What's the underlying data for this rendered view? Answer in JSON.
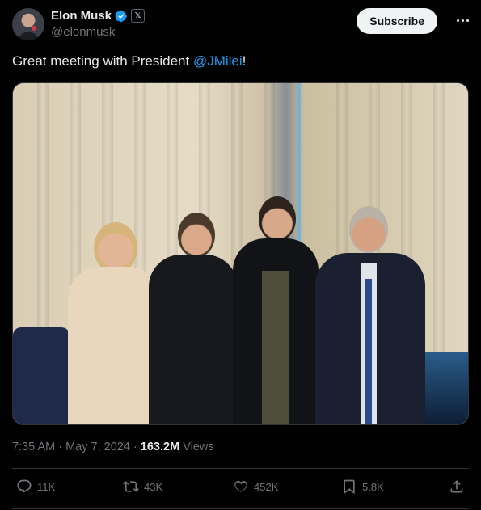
{
  "author": {
    "name": "Elon Musk",
    "handle": "@elonmusk",
    "affiliate_badge": "𝕏"
  },
  "header": {
    "subscribe_label": "Subscribe"
  },
  "tweet": {
    "text_prefix": "Great meeting with President ",
    "mention": "@JMilei",
    "text_suffix": "!"
  },
  "meta": {
    "time": "7:35 AM",
    "separator": " · ",
    "date": "May 7, 2024",
    "separator2": " · ",
    "views_count": "163.2M",
    "views_label": " Views"
  },
  "actions": {
    "replies": "11K",
    "reposts": "43K",
    "likes": "452K",
    "bookmarks": "5.8K"
  },
  "colors": {
    "accent": "#1d9bf0",
    "background": "#000000",
    "text": "#e7e9ea",
    "muted": "#71767b"
  },
  "icons": [
    "verified-badge-icon",
    "x-affiliate-icon",
    "more-icon",
    "reply-icon",
    "repost-icon",
    "like-icon",
    "bookmark-icon",
    "share-icon"
  ]
}
